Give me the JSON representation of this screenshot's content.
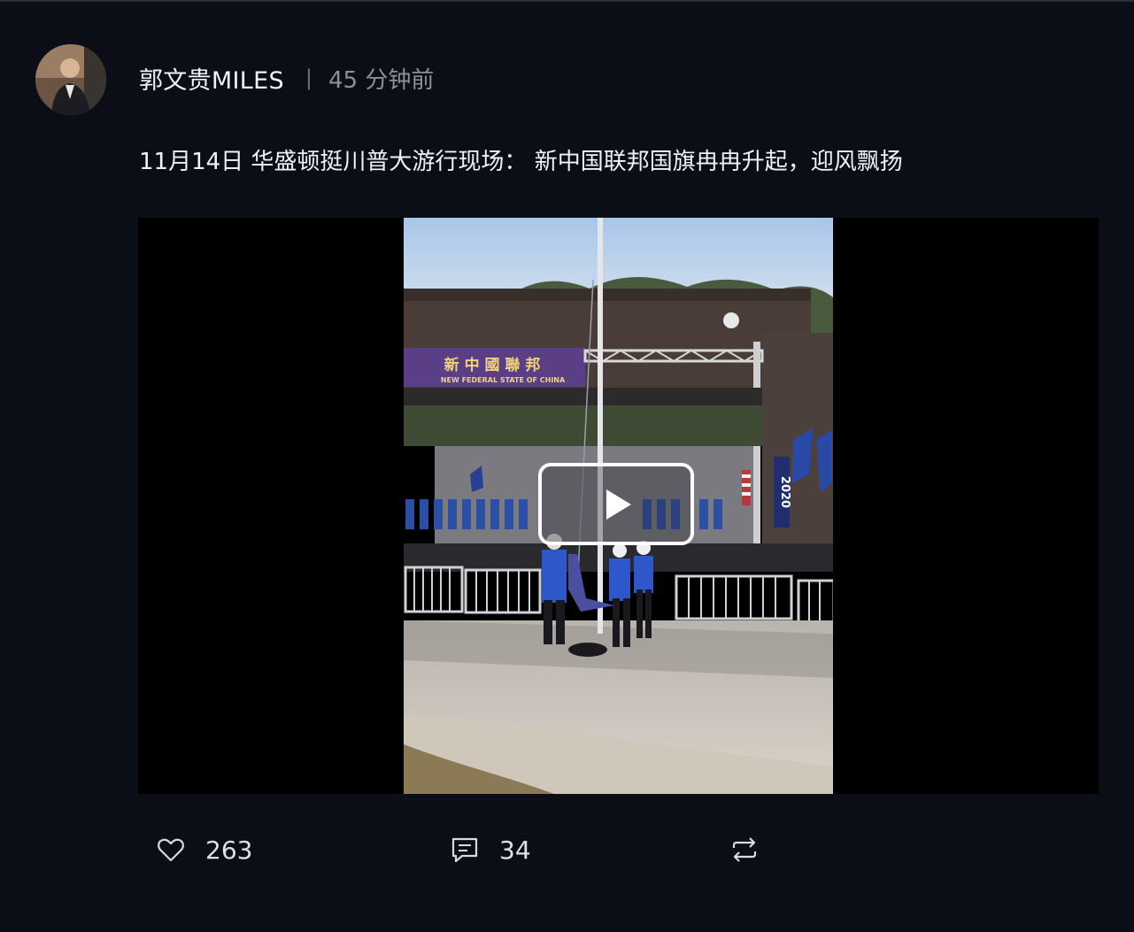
{
  "post": {
    "author": "郭文贵MILES",
    "separator": "|",
    "time": "45 分钟前",
    "caption": "11月14日 华盛顿挺川普大游行现场：  新中国联邦国旗冉冉升起，迎风飘扬",
    "video": {
      "banner_cn": "新 中 國 聯 邦",
      "banner_en": "NEW FEDERAL STATE OF CHINA",
      "sign_text": "2020"
    },
    "actions": {
      "like_count": "263",
      "comment_count": "34"
    }
  },
  "icons": {
    "like": "heart-icon",
    "comment": "comment-icon",
    "repost": "repost-icon",
    "play": "play-icon"
  }
}
